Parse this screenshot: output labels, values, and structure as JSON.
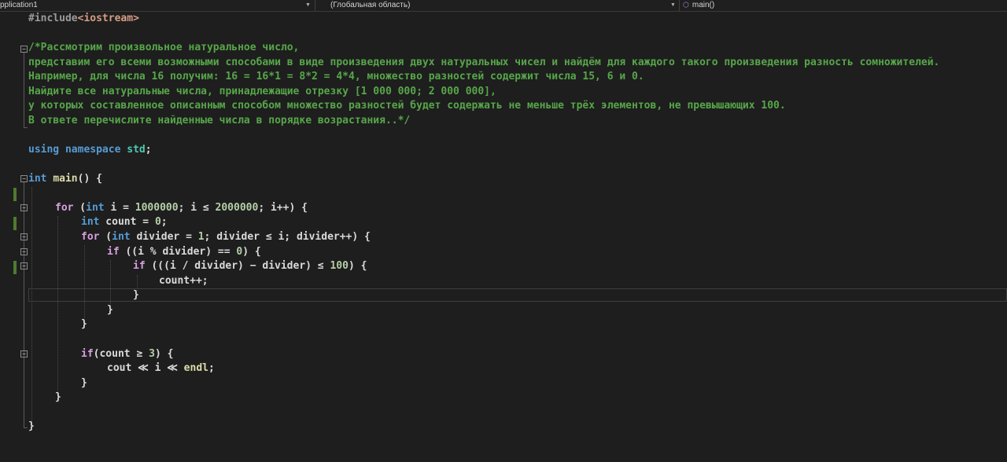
{
  "navbar": {
    "project": "pplication1",
    "scope": "(Глобальная область)",
    "member": "main()",
    "member_icon": "cube-icon"
  },
  "code": {
    "include": {
      "directive": "#include",
      "open": "<",
      "header": "iostream",
      "close": ">"
    },
    "comment": [
      "/*Рассмотрим произвольное натуральное число,",
      "представим его всеми возможными способами в виде произведения двух натуральных чисел и найдём для каждого такого произведения разность сомножителей.",
      "Например, для числа 16 получим: 16 = 16*1 = 8*2 = 4*4, множество разностей содержит числа 15, 6 и 0.",
      "Найдите все натуральные числа, принадлежащие отрезку [1 000 000; 2 000 000],",
      "у которых составленное описанным способом множество разностей будет содержать не меньше трёх элементов, не превышающих 100.",
      "В ответе перечислите найденные числа в порядке возрастания..*/"
    ],
    "using": {
      "kw1": "using",
      "kw2": "namespace",
      "ns": "std",
      "end": ";"
    },
    "main_sig": {
      "type": "int",
      "name": "main",
      "rest": "() {"
    },
    "for1": {
      "kw": "for",
      "p1": " (",
      "type": "int",
      "p2": " i = ",
      "n1": "1000000",
      "p3": "; i ≤ ",
      "n2": "2000000",
      "p4": "; i++) {"
    },
    "count_decl": {
      "type": "int",
      "p1": " count = ",
      "n": "0",
      "p2": ";"
    },
    "for2": {
      "kw": "for",
      "p1": " (",
      "type": "int",
      "p2": " divider = ",
      "n": "1",
      "p3": "; divider ≤ i; divider++) {"
    },
    "if1": {
      "kw": "if",
      "p1": " ((i % divider) == ",
      "n": "0",
      "p2": ") {"
    },
    "if2": {
      "kw": "if",
      "p1": " (((i / divider) − divider) ≤ ",
      "n": "100",
      "p2": ") {"
    },
    "count_inc": "count++;",
    "brace_close": "}",
    "if3": {
      "kw": "if",
      "p1": "(count ≥ ",
      "n": "3",
      "p2": ") {"
    },
    "cout": {
      "obj": "cout",
      "op1": " ≪ i ≪ ",
      "endl": "endl",
      "end": ";"
    }
  }
}
